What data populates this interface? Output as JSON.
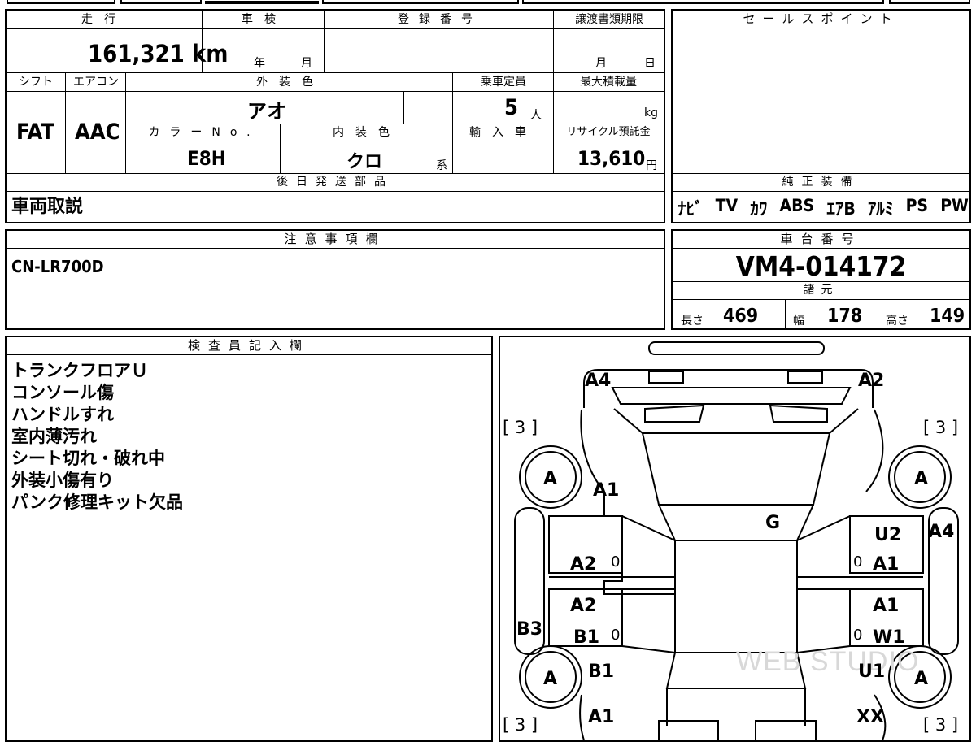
{
  "top_info": {
    "headers": {
      "mileage": "走行",
      "shaken": "車検",
      "registration": "登録番号",
      "transfer_deadline": "譲渡書類期限"
    },
    "mileage_value": "161,321 km",
    "shaken_year_unit": "年",
    "shaken_month_unit": "月",
    "transfer_month_unit": "月",
    "transfer_day_unit": "日"
  },
  "row2": {
    "headers": {
      "shift": "シフト",
      "aircon": "エアコン",
      "exterior_color": "外装色",
      "capacity": "乗車定員",
      "max_load": "最大積載量",
      "color_no": "カラーNo.",
      "interior_color": "内装色",
      "import": "輸入車",
      "recycle": "リサイクル預託金"
    },
    "shift_value": "FAT",
    "aircon_value": "AAC",
    "exterior_color_value": "アオ",
    "capacity_value": "5",
    "capacity_unit": "人",
    "max_load_unit": "kg",
    "color_no_value": "E8H",
    "interior_color_value": "クロ",
    "interior_color_suffix": "系",
    "recycle_value": "13,610",
    "recycle_unit": "円"
  },
  "later_parts": {
    "header": "後日発送部品",
    "value": "車両取説"
  },
  "sales_point": {
    "header": "セールスポイント"
  },
  "equipment": {
    "header": "純正装備",
    "items": [
      "ﾅﾋﾞ",
      "TV",
      "ｶﾜ",
      "ABS",
      "ｴｱB",
      "ｱﾙﾐ",
      "PS",
      "PW"
    ]
  },
  "notes": {
    "header": "注意事項欄",
    "value": "CN-LR700D"
  },
  "chassis": {
    "header": "車台番号",
    "value": "VM4-014172"
  },
  "specs": {
    "header": "諸元",
    "length_label": "長さ",
    "length_value": "469",
    "width_label": "幅",
    "width_value": "178",
    "height_label": "高さ",
    "height_value": "149"
  },
  "inspector": {
    "header": "検査員記入欄",
    "lines": [
      "トランクフロアＵ",
      "コンソール傷",
      "ハンドルすれ",
      "室内薄汚れ",
      "シート切れ・破れ中",
      "外装小傷有り",
      "パンク修理キット欠品"
    ]
  },
  "diagram": {
    "marks": {
      "a4_front_left": "A4",
      "a2_front_right": "A2",
      "bracket_fl": "[ 3 ]",
      "bracket_fr": "[ 3 ]",
      "bracket_rl": "[ 3 ]",
      "bracket_rr": "[ 3 ]",
      "tire_fl": "A",
      "tire_fr": "A",
      "tire_rl": "A",
      "tire_rr": "A",
      "a1_left_fender": "A1",
      "g_windshield": "G",
      "u2_right_fender": "U2",
      "a4_right_side": "A4",
      "a2_left_front_door": "A2",
      "a1_right_front_door": "A1",
      "a2_left_rear_door": "A2",
      "b1_left_rear_door": "B1",
      "a1_right_rear_door": "A1",
      "w1_right_rear_door": "W1",
      "b3_left_sill": "B3",
      "b1_left_rear_fender": "B1",
      "u1_right_rear_fender": "U1",
      "a1_rear_left": "A1",
      "xx_rear_right": "XX",
      "zero_1": "0",
      "zero_2": "0",
      "zero_3": "0",
      "zero_4": "0"
    },
    "watermark": "WEB STUDIO"
  }
}
